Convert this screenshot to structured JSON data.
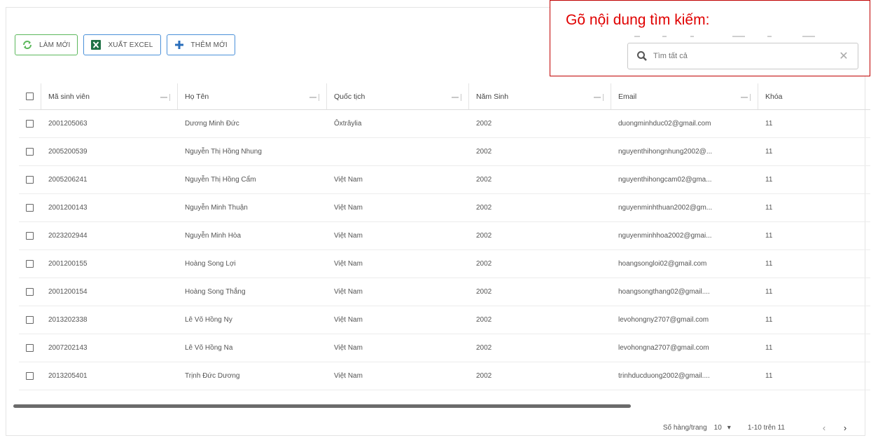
{
  "toolbar": {
    "refresh_label": "LÀM MỚI",
    "export_label": "XUẤT EXCEL",
    "add_label": "THÊM MỚI"
  },
  "annotation": {
    "text": "Gõ nội dung tìm kiếm:"
  },
  "search": {
    "placeholder": "Tìm tất cả"
  },
  "table": {
    "columns": [
      "Mã sinh viên",
      "Họ Tên",
      "Quốc tịch",
      "Năm Sinh",
      "Email",
      "Khóa"
    ],
    "rows": [
      [
        "2001205063",
        "Dương Minh Đức",
        "Ôxtrâylia",
        "2002",
        "duongminhduc02@gmail.com",
        "11"
      ],
      [
        "2005200539",
        "Nguyễn Thị Hồng Nhung",
        "",
        "2002",
        "nguyenthihongnhung2002@...",
        "11"
      ],
      [
        "2005206241",
        "Nguyễn Thị Hồng Cẩm",
        "Việt Nam",
        "2002",
        "nguyenthihongcam02@gma...",
        "11"
      ],
      [
        "2001200143",
        "Nguyễn Minh Thuận",
        "Việt Nam",
        "2002",
        "nguyenminhthuan2002@gm...",
        "11"
      ],
      [
        "2023202944",
        "Nguyễn Minh Hòa",
        "Việt Nam",
        "2002",
        "nguyenminhhoa2002@gmai...",
        "11"
      ],
      [
        "2001200155",
        "Hoàng Song Lợi",
        "Việt Nam",
        "2002",
        "hoangsongloi02@gmail.com",
        "11"
      ],
      [
        "2001200154",
        "Hoàng Song Thắng",
        "Việt Nam",
        "2002",
        "hoangsongthang02@gmail....",
        "11"
      ],
      [
        "2013202338",
        "Lê Võ Hồng Ny",
        "Việt Nam",
        "2002",
        "levohongny2707@gmail.com",
        "11"
      ],
      [
        "2007202143",
        "Lê Võ Hồng Na",
        "Việt Nam",
        "2002",
        "levohongna2707@gmail.com",
        "11"
      ],
      [
        "2013205401",
        "Trịnh Đức Dương",
        "Việt Nam",
        "2002",
        "trinhducduong2002@gmail....",
        "11"
      ]
    ]
  },
  "pager": {
    "rows_per_page_label": "Số hàng/trang",
    "rows_per_page_value": "10",
    "range_text": "1-10 trên 11"
  },
  "colors": {
    "accent_blue": "#4a90d9",
    "refresh_green": "#5cb85c",
    "excel_green": "#1e7145",
    "annotation_red": "#e00000"
  }
}
